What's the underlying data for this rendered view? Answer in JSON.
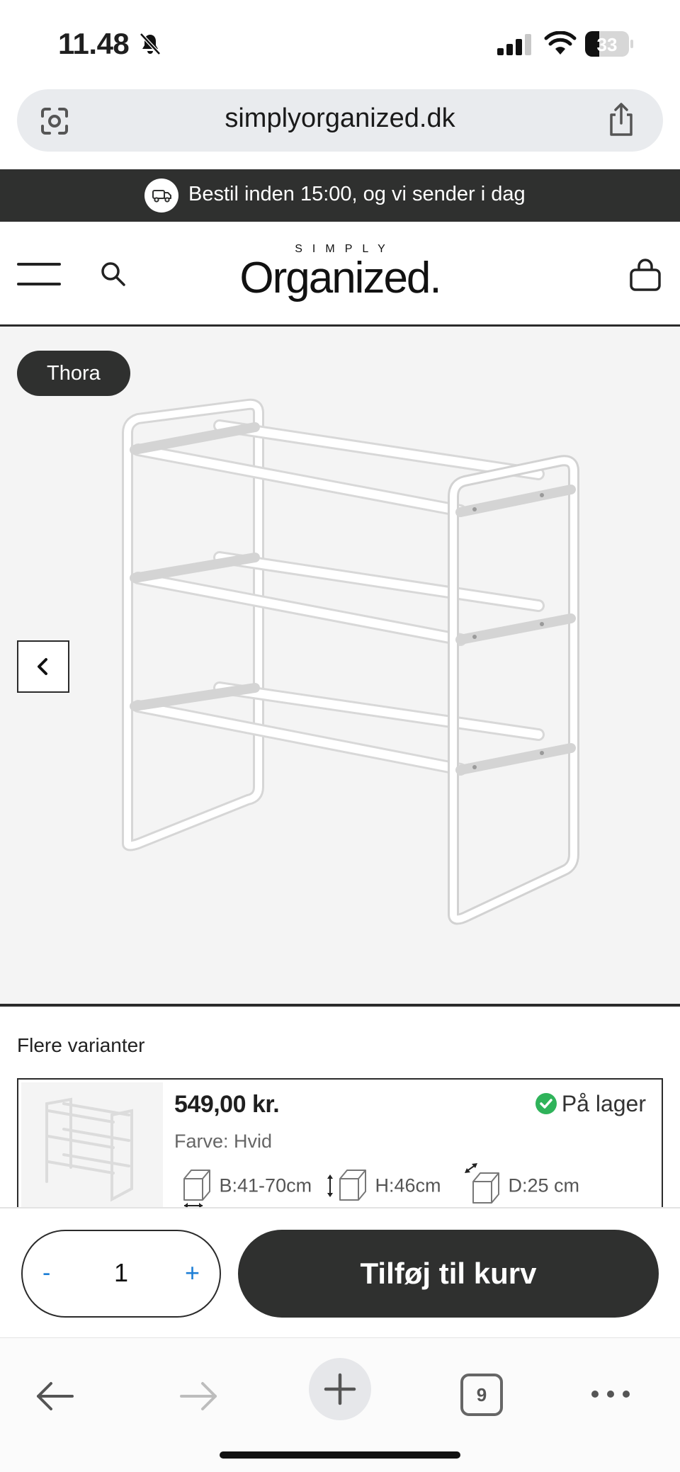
{
  "status_bar": {
    "time": "11.48",
    "battery": "33",
    "battery_level": 0.33
  },
  "browser": {
    "url": "simplyorganized.dk",
    "tab_count": "9"
  },
  "promo": {
    "text": "Bestil inden 15:00, og vi sender i dag"
  },
  "header": {
    "logo_small": "SIMPLY",
    "logo_big": "Organized."
  },
  "gallery": {
    "tag": "Thora"
  },
  "variants": {
    "title": "Flere varianter",
    "items": [
      {
        "price": "549,00 kr.",
        "stock": "På lager",
        "color": "Farve: Hvid",
        "width": "B:41-70cm",
        "height": "H:46cm",
        "depth": "D:25 cm"
      }
    ]
  },
  "cart": {
    "minus": "-",
    "quantity": "1",
    "plus": "+",
    "add_label": "Tilføj til kurv"
  },
  "colors": {
    "dark": "#2f302f",
    "accent_blue": "#1f7fd6",
    "stock_green": "#2fb35a"
  }
}
